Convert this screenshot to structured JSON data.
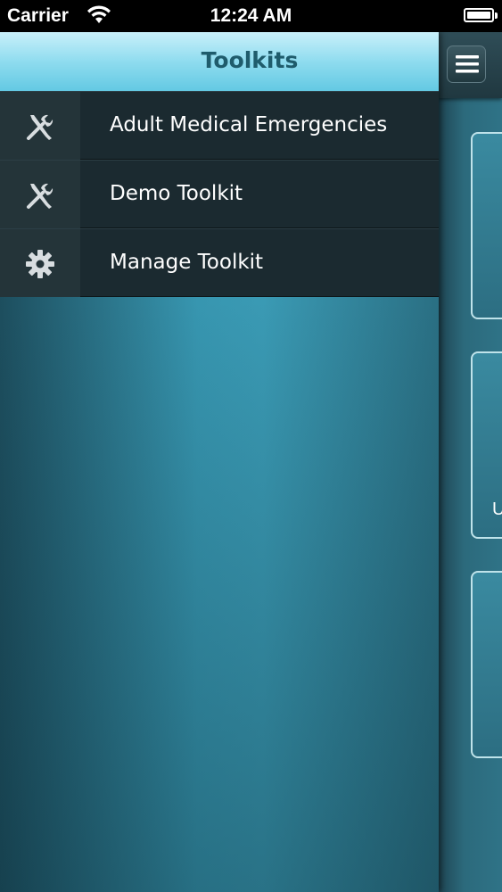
{
  "status_bar": {
    "carrier": "Carrier",
    "time": "12:24 AM",
    "wifi_icon": "wifi-icon",
    "battery_level": 1.0
  },
  "drawer": {
    "title": "Toolkits",
    "items": [
      {
        "label": "Adult Medical Emergencies",
        "icon": "wrench-screwdriver-icon"
      },
      {
        "label": "Demo Toolkit",
        "icon": "wrench-screwdriver-icon"
      },
      {
        "label": "Manage Toolkit",
        "icon": "gear-icon"
      }
    ]
  },
  "back_panel": {
    "menu_icon": "hamburger-menu-icon",
    "card_2_letter": "U"
  },
  "colors": {
    "header_gradient_top": "#c9f0fa",
    "title_text": "#1f5c6c",
    "menu_item_bg": "#1b2a30",
    "card_border": "#bfe3ea"
  }
}
